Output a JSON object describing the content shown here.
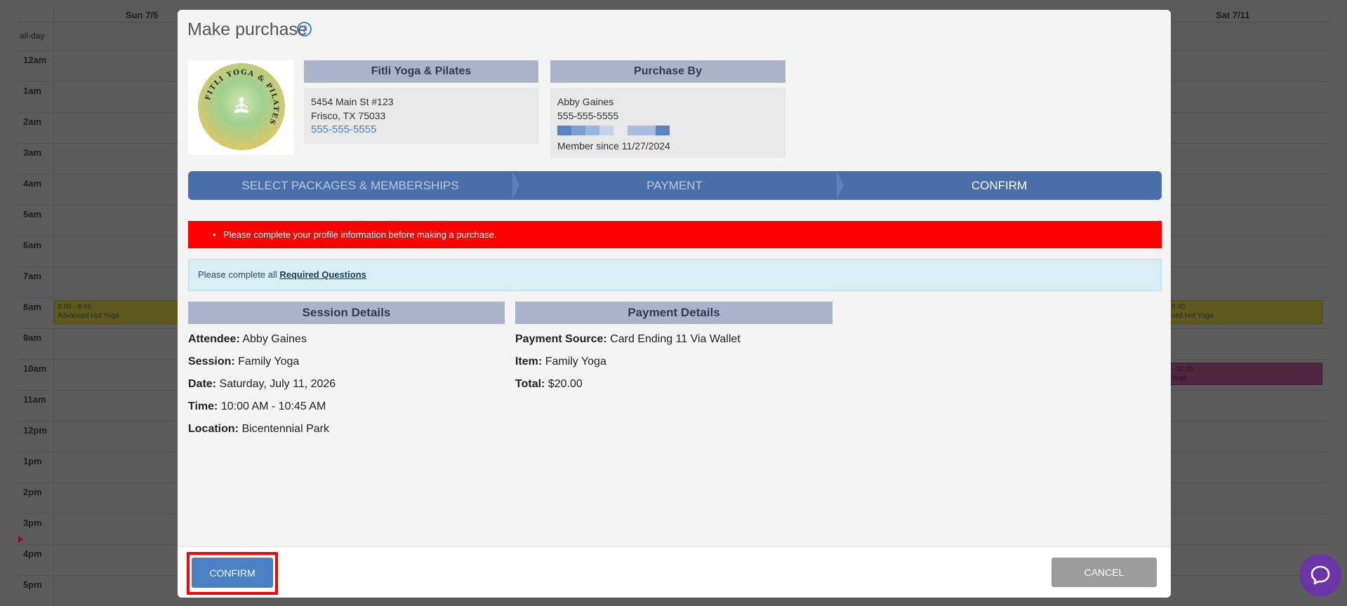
{
  "calendar": {
    "days": [
      {
        "label": "Sun 7/5"
      },
      {
        "label": "Sat 7/11"
      }
    ],
    "allday_label": "all-day",
    "hours": [
      "12am",
      "1am",
      "2am",
      "3am",
      "4am",
      "5am",
      "6am",
      "7am",
      "8am",
      "9am",
      "10am",
      "11am",
      "12pm",
      "1pm",
      "2pm",
      "3pm",
      "4pm",
      "5pm"
    ],
    "events": [
      {
        "time": "8:00 - 8:45",
        "title": "Advanced Hot Yoga"
      },
      {
        "time": "8:45",
        "title": "ced Hot Yoga"
      },
      {
        "time": "- 10:45",
        "title": "Yoga"
      }
    ]
  },
  "modal": {
    "title": "Make purchase",
    "studio": {
      "logo_text": "FITLI YOGA & PILATES",
      "name": "Fitli Yoga & Pilates",
      "address_line1": "5454 Main St #123",
      "address_line2": "Frisco, TX 75033",
      "phone": "555-555-5555"
    },
    "purchaser": {
      "header": "Purchase By",
      "name": "Abby Gaines",
      "phone": "555-555-5555",
      "member_since": "Member since 11/27/2024"
    },
    "steps": [
      {
        "label": "SELECT PACKAGES & MEMBERSHIPS",
        "active": false
      },
      {
        "label": "PAYMENT",
        "active": false
      },
      {
        "label": "CONFIRM",
        "active": true
      }
    ],
    "error_message": "Please complete your profile information before making a purchase.",
    "info_message": {
      "prefix": "Please complete all ",
      "link": "Required Questions"
    },
    "session_details": {
      "header": "Session Details",
      "rows": [
        {
          "label": "Attendee:",
          "value": "Abby Gaines"
        },
        {
          "label": "Session:",
          "value": "Family Yoga"
        },
        {
          "label": "Date:",
          "value": "Saturday, July 11, 2026"
        },
        {
          "label": "Time:",
          "value": "10:00 AM - 10:45 AM"
        },
        {
          "label": "Location:",
          "value": "Bicentennial Park"
        }
      ]
    },
    "payment_details": {
      "header": "Payment Details",
      "rows": [
        {
          "label": "Payment Source:",
          "value": "Card Ending 11 Via Wallet"
        },
        {
          "label": "Item:",
          "value": "Family Yoga"
        },
        {
          "label": "Total:",
          "value": "$20.00"
        }
      ]
    },
    "buttons": {
      "confirm": "CONFIRM",
      "cancel": "CANCEL"
    }
  },
  "colors": {
    "accent": "#4a80c4",
    "step_bar": "#4a6ea7",
    "error": "#ff0000",
    "highlight": "#ff0000",
    "chat": "#6b35a8"
  },
  "icons": {
    "help": "help-icon",
    "chat": "chat-icon"
  }
}
